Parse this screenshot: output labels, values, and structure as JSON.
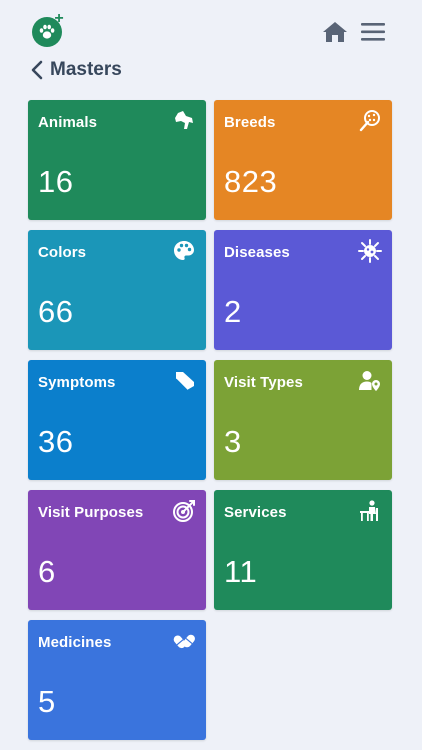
{
  "header": {
    "logo_icon": "paw-plus-logo-icon",
    "home_icon": "home-icon",
    "menu_icon": "hamburger-menu-icon"
  },
  "breadcrumb": {
    "back_icon": "chevron-left-icon",
    "title": "Masters"
  },
  "tiles": [
    {
      "label": "Animals",
      "count": "16",
      "color": "#1f8a5b",
      "icon": "animals-icon"
    },
    {
      "label": "Breeds",
      "count": "823",
      "color": "#e58624",
      "icon": "breeds-icon"
    },
    {
      "label": "Colors",
      "count": "66",
      "color": "#1b96b8",
      "icon": "palette-icon"
    },
    {
      "label": "Diseases",
      "count": "2",
      "color": "#5b59d6",
      "icon": "virus-icon"
    },
    {
      "label": "Symptoms",
      "count": "36",
      "color": "#0b7fcc",
      "icon": "symptoms-icon"
    },
    {
      "label": "Visit Types",
      "count": "3",
      "color": "#7ca236",
      "icon": "user-location-icon"
    },
    {
      "label": "Visit Purposes",
      "count": "6",
      "color": "#8146b6",
      "icon": "target-icon"
    },
    {
      "label": "Services",
      "count": "11",
      "color": "#1f8a5b",
      "icon": "services-icon"
    },
    {
      "label": "Medicines",
      "count": "5",
      "color": "#3a74dd",
      "icon": "pills-icon"
    }
  ]
}
